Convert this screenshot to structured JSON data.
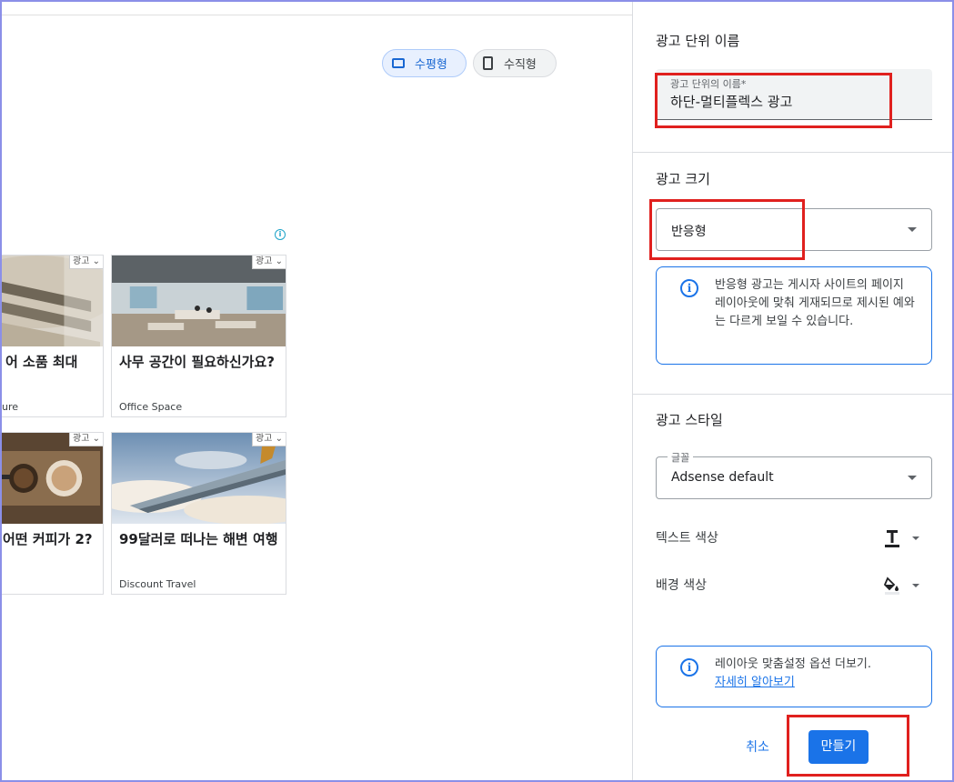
{
  "preview": {
    "orientation": {
      "horizontal": "수평형",
      "vertical": "수직형"
    },
    "ads": [
      {
        "title": "어 소품 최대",
        "source": "ure",
        "badge": "광고",
        "image": "pillows"
      },
      {
        "title": "사무 공간이 필요하신가요?",
        "source": "Office Space",
        "badge": "광고",
        "image": "office"
      },
      {
        "title": "어떤 커피가 2?",
        "source": "",
        "badge": "광고",
        "image": "coffee"
      },
      {
        "title": "99달러로 떠나는 해변 여행",
        "source": "Discount Travel",
        "badge": "광고",
        "image": "airplane"
      }
    ]
  },
  "panel": {
    "name_section": {
      "title": "광고 단위 이름",
      "field_label": "광고 단위의 이름*",
      "field_value": "하단-멀티플렉스 광고"
    },
    "size_section": {
      "title": "광고 크기",
      "select_value": "반응형",
      "info_text": "반응형 광고는 게시자 사이트의 페이지 레이아웃에 맞춰 게재되므로 제시된 예와는 다르게 보일 수 있습니다."
    },
    "style_section": {
      "title": "광고 스타일",
      "font_legend": "글꼴",
      "font_value": "Adsense default",
      "text_color_label": "텍스트 색상",
      "bg_color_label": "배경 색상",
      "info_text": "레이아웃 맞춤설정 옵션 더보기.",
      "info_link": "자세히 알아보기"
    },
    "actions": {
      "cancel": "취소",
      "create": "만들기"
    }
  },
  "colors": {
    "primary": "#1a73e8",
    "highlight": "#e0201e",
    "frame": "#8b8fe8"
  }
}
